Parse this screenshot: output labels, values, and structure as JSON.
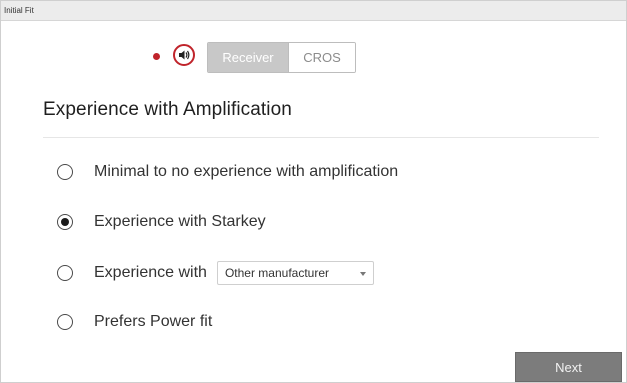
{
  "window": {
    "title": "Initial Fit"
  },
  "toolbar": {
    "mode_options": [
      "Receiver",
      "CROS"
    ],
    "selected_mode": "Receiver",
    "status_dot_color": "#c0242b",
    "speaker_icon": "speaker-icon"
  },
  "section": {
    "title": "Experience with Amplification"
  },
  "options": [
    {
      "label": "Minimal to no experience with amplification",
      "selected": false
    },
    {
      "label": "Experience with Starkey",
      "selected": true
    },
    {
      "label": "Experience with",
      "selected": false,
      "dropdown_value": "Other manufacturer"
    },
    {
      "label": "Prefers Power fit",
      "selected": false
    }
  ],
  "footer": {
    "next_label": "Next"
  }
}
